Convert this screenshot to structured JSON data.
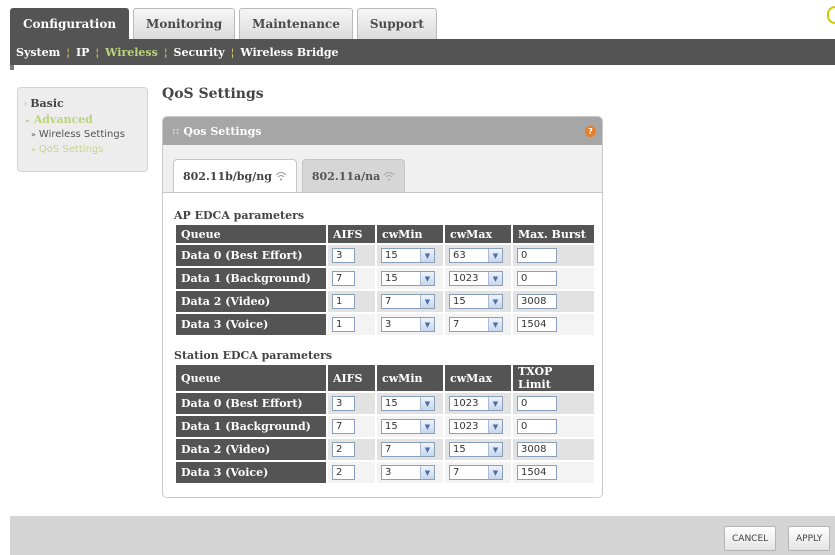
{
  "top_tabs": [
    "Configuration",
    "Monitoring",
    "Maintenance",
    "Support"
  ],
  "subnav": [
    "System",
    "IP",
    "Wireless",
    "Security",
    "Wireless Bridge"
  ],
  "left_menu": {
    "basic": "Basic",
    "advanced": "Advanced",
    "wireless_settings": "Wireless Settings",
    "qos_settings": "QoS Settings"
  },
  "page_title": "QoS Settings",
  "panel": {
    "title": "Qos Settings",
    "help": "?",
    "tabs": [
      "802.11b/bg/ng",
      "802.11a/na"
    ]
  },
  "ap_edca": {
    "label": "AP EDCA parameters",
    "headers": [
      "Queue",
      "AIFS",
      "cwMin",
      "cwMax",
      "Max. Burst"
    ],
    "rows": [
      {
        "queue": "Data 0 (Best Effort)",
        "aifs": "3",
        "cwmin": "15",
        "cwmax": "63",
        "last": "0"
      },
      {
        "queue": "Data 1 (Background)",
        "aifs": "7",
        "cwmin": "15",
        "cwmax": "1023",
        "last": "0"
      },
      {
        "queue": "Data 2 (Video)",
        "aifs": "1",
        "cwmin": "7",
        "cwmax": "15",
        "last": "3008"
      },
      {
        "queue": "Data 3 (Voice)",
        "aifs": "1",
        "cwmin": "3",
        "cwmax": "7",
        "last": "1504"
      }
    ]
  },
  "station_edca": {
    "label": "Station EDCA parameters",
    "headers": [
      "Queue",
      "AIFS",
      "cwMin",
      "cwMax",
      "TXOP Limit"
    ],
    "rows": [
      {
        "queue": "Data 0 (Best Effort)",
        "aifs": "3",
        "cwmin": "15",
        "cwmax": "1023",
        "last": "0"
      },
      {
        "queue": "Data 1 (Background)",
        "aifs": "7",
        "cwmin": "15",
        "cwmax": "1023",
        "last": "0"
      },
      {
        "queue": "Data 2 (Video)",
        "aifs": "2",
        "cwmin": "7",
        "cwmax": "15",
        "last": "3008"
      },
      {
        "queue": "Data 3 (Voice)",
        "aifs": "2",
        "cwmin": "3",
        "cwmax": "7",
        "last": "1504"
      }
    ]
  },
  "buttons": {
    "cancel": "CANCEL",
    "apply": "APPLY"
  },
  "colors": {
    "accent": "#bcd37c",
    "bar": "#545454",
    "help": "#e87d2a"
  }
}
